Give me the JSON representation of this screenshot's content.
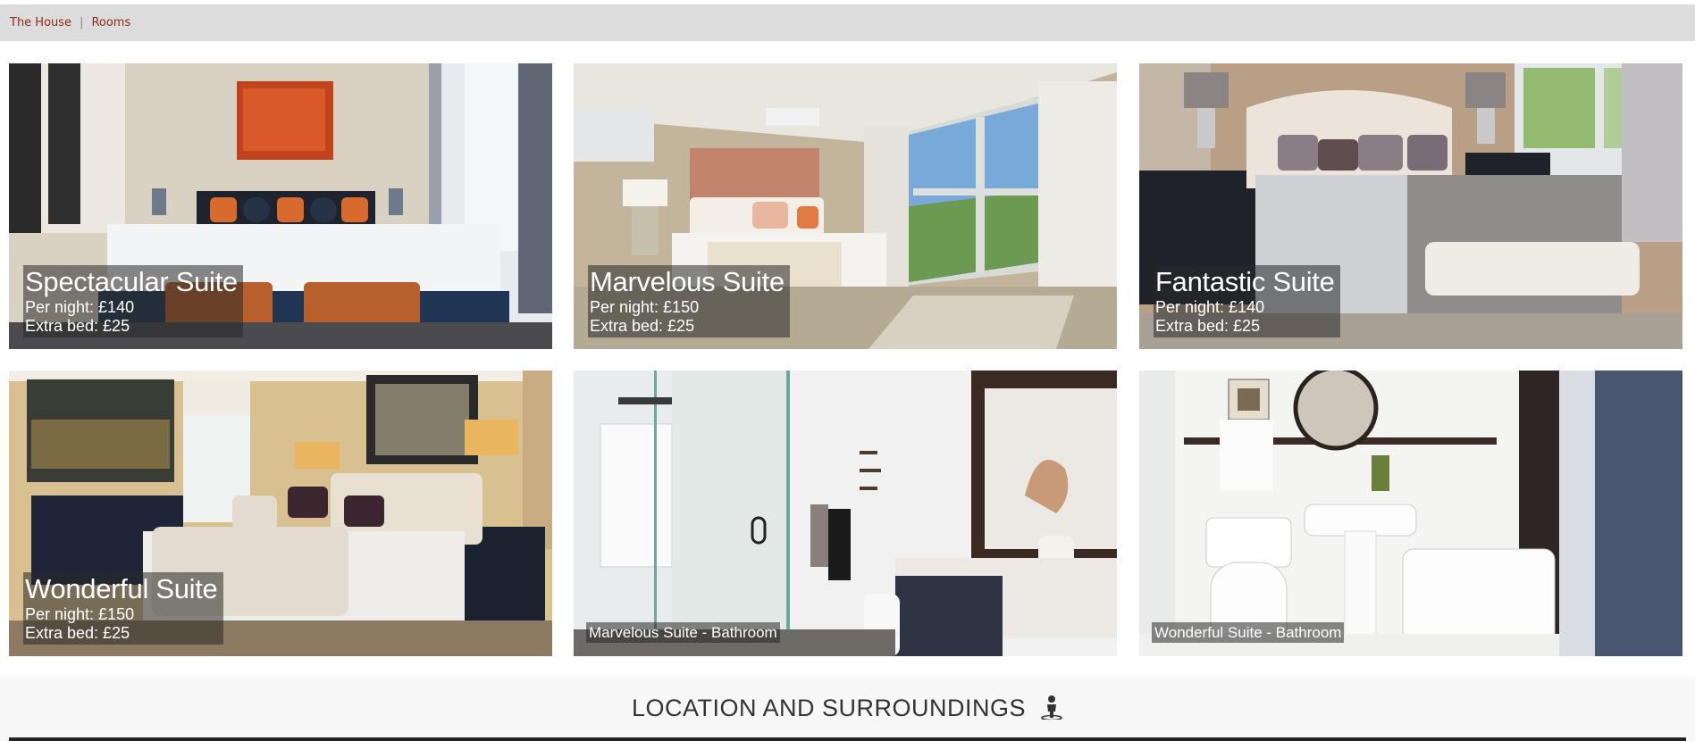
{
  "breadcrumb": {
    "items": [
      "The House",
      "Rooms"
    ],
    "separator": "|"
  },
  "rooms": [
    {
      "name": "Spectacular Suite",
      "per_night": "Per night: £140",
      "extra_bed": "Extra bed: £25"
    },
    {
      "name": "Marvelous Suite",
      "per_night": "Per night: £150",
      "extra_bed": "Extra bed: £25"
    },
    {
      "name": "Fantastic Suite",
      "per_night": "Per night: £140",
      "extra_bed": "Extra bed: £25"
    },
    {
      "name": "Wonderful Suite",
      "per_night": "Per night: £150",
      "extra_bed": "Extra bed: £25"
    }
  ],
  "bathrooms": [
    {
      "caption": "Marvelous Suite - Bathroom"
    },
    {
      "caption": "Wonderful Suite - Bathroom"
    }
  ],
  "location": {
    "title": "LOCATION AND SURROUNDINGS",
    "icon": "person-walking-icon"
  },
  "colors": {
    "breadcrumb_link": "#8b2b1a",
    "breadcrumb_bg": "#dcdcdc",
    "caption_bg": "rgba(40,40,40,0.55)"
  }
}
